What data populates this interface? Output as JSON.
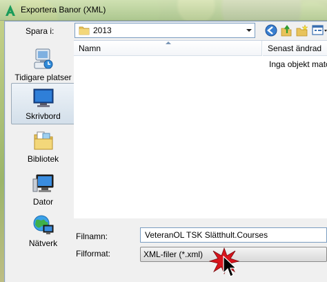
{
  "window": {
    "title": "Exportera Banor (XML)",
    "icon": "app-a-icon"
  },
  "lookin": {
    "label": "Spara i:",
    "value": "2013",
    "icon": "folder-icon"
  },
  "toolbar": {
    "back_icon": "back-icon",
    "up_icon": "up-folder-icon",
    "new_folder_icon": "new-folder-icon",
    "view_menu_icon": "view-menu-icon"
  },
  "places": [
    {
      "label": "Tidigare platser",
      "icon": "recent-places-icon"
    },
    {
      "label": "Skrivbord",
      "icon": "desktop-icon"
    },
    {
      "label": "Bibliotek",
      "icon": "libraries-icon"
    },
    {
      "label": "Dator",
      "icon": "computer-icon"
    },
    {
      "label": "Nätverk",
      "icon": "network-icon"
    }
  ],
  "filelist": {
    "columns": [
      "Namn",
      "Senast ändrad"
    ],
    "empty_message": "Inga objekt matchade"
  },
  "filename": {
    "label": "Filnamn:",
    "value": "VeteranOL TSK Slätthult.Courses"
  },
  "filetype": {
    "label": "Filformat:",
    "value": "XML-filer (*.xml)"
  },
  "colors": {
    "selection": "#d3dfea",
    "border_accent": "#7a9cc0",
    "app_icon": "#1a9b5a",
    "burst": "#d8141c"
  }
}
